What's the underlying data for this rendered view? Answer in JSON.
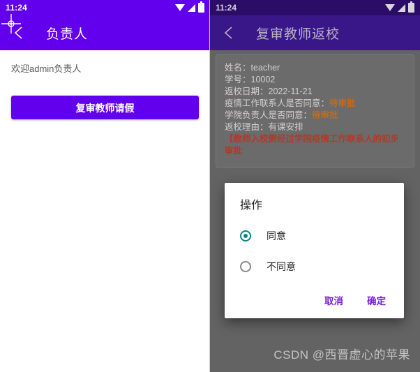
{
  "left_screen": {
    "status_bar": {
      "clock": "11:24",
      "icons": [
        "wifi-icon",
        "signal-icon",
        "battery-icon"
      ]
    },
    "app_bar": {
      "back_icon": "back-arrow-icon",
      "title": "负责人"
    },
    "welcome_text": "欢迎admin负责人",
    "primary_button": "复审教师请假"
  },
  "right_screen": {
    "status_bar": {
      "clock": "11:24",
      "icons": [
        "wifi-icon",
        "signal-icon",
        "battery-icon"
      ]
    },
    "app_bar": {
      "back_icon": "back-arrow-icon",
      "title": "复审教师返校"
    },
    "info": {
      "name_label": "姓名：",
      "name_value": "teacher",
      "id_label": "学号：",
      "id_value": "10002",
      "date_label": "返校日期：",
      "date_value": "2022-11-21",
      "contact_label": "疫情工作联系人是否同意：",
      "contact_value": "待审批",
      "dean_label": "学院负责人是否同意：",
      "dean_value": "待审批",
      "reason_label": "返校理由：",
      "reason_value": "有课安排",
      "warning_text": "【教师入校需经过学院疫情工作联系人的初步审批"
    },
    "watermark": "CSDN @西晋虚心的苹果"
  },
  "dialog": {
    "title": "操作",
    "options": [
      {
        "label": "同意",
        "checked": true
      },
      {
        "label": "不同意",
        "checked": false
      }
    ],
    "cancel_label": "取消",
    "confirm_label": "确定"
  },
  "colors": {
    "primary_purple": "#6200EE",
    "dim_purple": "#3a1789",
    "dim_background": "#636363",
    "radio_teal": "#018786",
    "dialog_action_purple": "#7b1fe0",
    "pending_orange": "#c26b1c",
    "warning_red": "#b03a2a"
  }
}
